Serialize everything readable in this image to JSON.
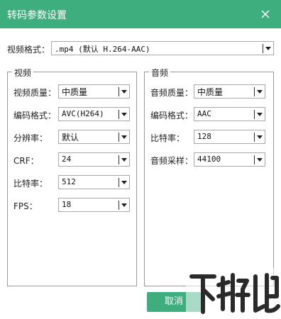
{
  "window": {
    "title": "转码参数设置"
  },
  "video_format": {
    "label": "视频格式：",
    "value": ".mp4 (默认 H.264-AAC)"
  },
  "video_group": {
    "legend": "视频",
    "fields": [
      {
        "label": "视频质量：",
        "value": "中质量"
      },
      {
        "label": "编码格式：",
        "value": "AVC(H264)"
      },
      {
        "label": "分辨率：",
        "value": "默认"
      },
      {
        "label": "CRF：",
        "value": "24"
      },
      {
        "label": "比特率：",
        "value": "512"
      },
      {
        "label": "FPS：",
        "value": "18"
      }
    ]
  },
  "audio_group": {
    "legend": "音频",
    "fields": [
      {
        "label": "音频质量：",
        "value": "中质量"
      },
      {
        "label": "编码格式：",
        "value": "AAC"
      },
      {
        "label": "比特率：",
        "value": "128"
      },
      {
        "label": "音频采样：",
        "value": "44100"
      }
    ]
  },
  "buttons": {
    "cancel": "取消"
  },
  "watermark": {
    "text": "下载吧"
  },
  "colors": {
    "accent": "#3fae7e"
  }
}
